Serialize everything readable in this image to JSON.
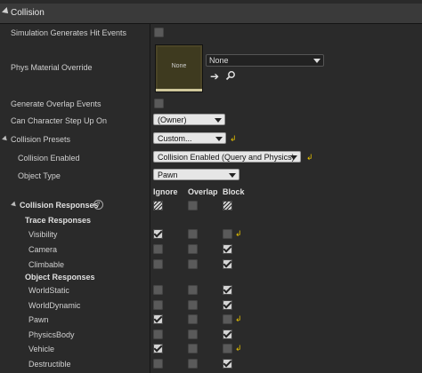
{
  "section": {
    "title": "Collision"
  },
  "props": {
    "sim_hit": "Simulation Generates Hit Events",
    "phys_mat": "Phys Material Override",
    "phys_thumb": "None",
    "phys_combo": "None",
    "overlap": "Generate Overlap Events",
    "step_up": "Can Character Step Up On",
    "step_up_value": "(Owner)",
    "presets": "Collision Presets",
    "presets_value": "Custom...",
    "enabled": "Collision Enabled",
    "enabled_value": "Collision Enabled (Query and Physics)",
    "object_type": "Object Type",
    "object_type_value": "Pawn"
  },
  "responses": {
    "title": "Collision Responses",
    "help": "?",
    "cols": [
      "Ignore",
      "Overlap",
      "Block"
    ],
    "trace_title": "Trace Responses",
    "object_title": "Object Responses",
    "trace_rows": [
      {
        "label": "Visibility",
        "state": [
          true,
          false,
          false
        ],
        "reset": true
      },
      {
        "label": "Camera",
        "state": [
          false,
          false,
          true
        ],
        "reset": false
      },
      {
        "label": "Climbable",
        "state": [
          false,
          false,
          true
        ],
        "reset": false
      }
    ],
    "object_rows": [
      {
        "label": "WorldStatic",
        "state": [
          false,
          false,
          true
        ],
        "reset": false
      },
      {
        "label": "WorldDynamic",
        "state": [
          false,
          false,
          true
        ],
        "reset": false
      },
      {
        "label": "Pawn",
        "state": [
          true,
          false,
          false
        ],
        "reset": true
      },
      {
        "label": "PhysicsBody",
        "state": [
          false,
          false,
          true
        ],
        "reset": false
      },
      {
        "label": "Vehicle",
        "state": [
          true,
          false,
          false
        ],
        "reset": true
      },
      {
        "label": "Destructible",
        "state": [
          false,
          false,
          true
        ],
        "reset": false
      }
    ]
  },
  "colors": {
    "reset_arrow": "#e5c100",
    "panel_bg": "#2a2a2a",
    "header_bg": "#3a3a3a"
  },
  "icons": {
    "reset": "reset-arrow-icon",
    "browse": "arrow-left-icon",
    "find": "search-icon",
    "help": "help-icon"
  }
}
